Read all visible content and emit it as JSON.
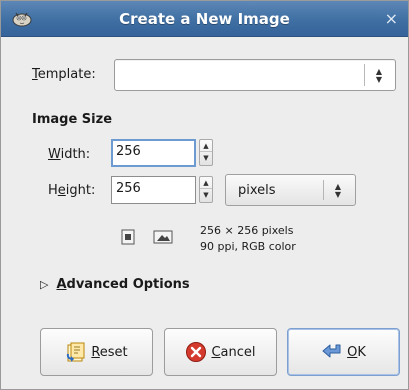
{
  "window": {
    "title": "Create a New Image",
    "close_glyph": "×",
    "app_icon": "gimp-wilber-icon"
  },
  "template": {
    "label_mnemonic": "T",
    "label_rest": "emplate:",
    "value": ""
  },
  "image_size": {
    "section_title": "Image Size",
    "width_label_mnemonic": "W",
    "width_label_rest": "idth:",
    "width_value": "256",
    "height_label_pre": "H",
    "height_label_mnemonic": "e",
    "height_label_post": "ight:",
    "height_value": "256",
    "unit": "pixels",
    "chain_icon": "chain-link-icon",
    "portrait_icon": "portrait-orientation-icon",
    "landscape_icon": "landscape-orientation-icon",
    "info_line1": "256 × 256 pixels",
    "info_line2": "90 ppi, RGB color"
  },
  "advanced": {
    "toggle_glyph": "▷",
    "label_mnemonic": "A",
    "label_rest": "dvanced Options",
    "expanded": false
  },
  "buttons": {
    "reset_mnemonic": "R",
    "reset_rest": "eset",
    "reset_icon": "reset-icon",
    "cancel_mnemonic": "C",
    "cancel_rest": "ancel",
    "cancel_icon": "cancel-icon",
    "ok_mnemonic": "O",
    "ok_rest": "K",
    "ok_icon": "ok-return-arrow-icon"
  },
  "colors": {
    "titlebar": "#3f6fa3",
    "focus_border": "#6e9ad2",
    "cancel_red": "#d43b2e"
  }
}
